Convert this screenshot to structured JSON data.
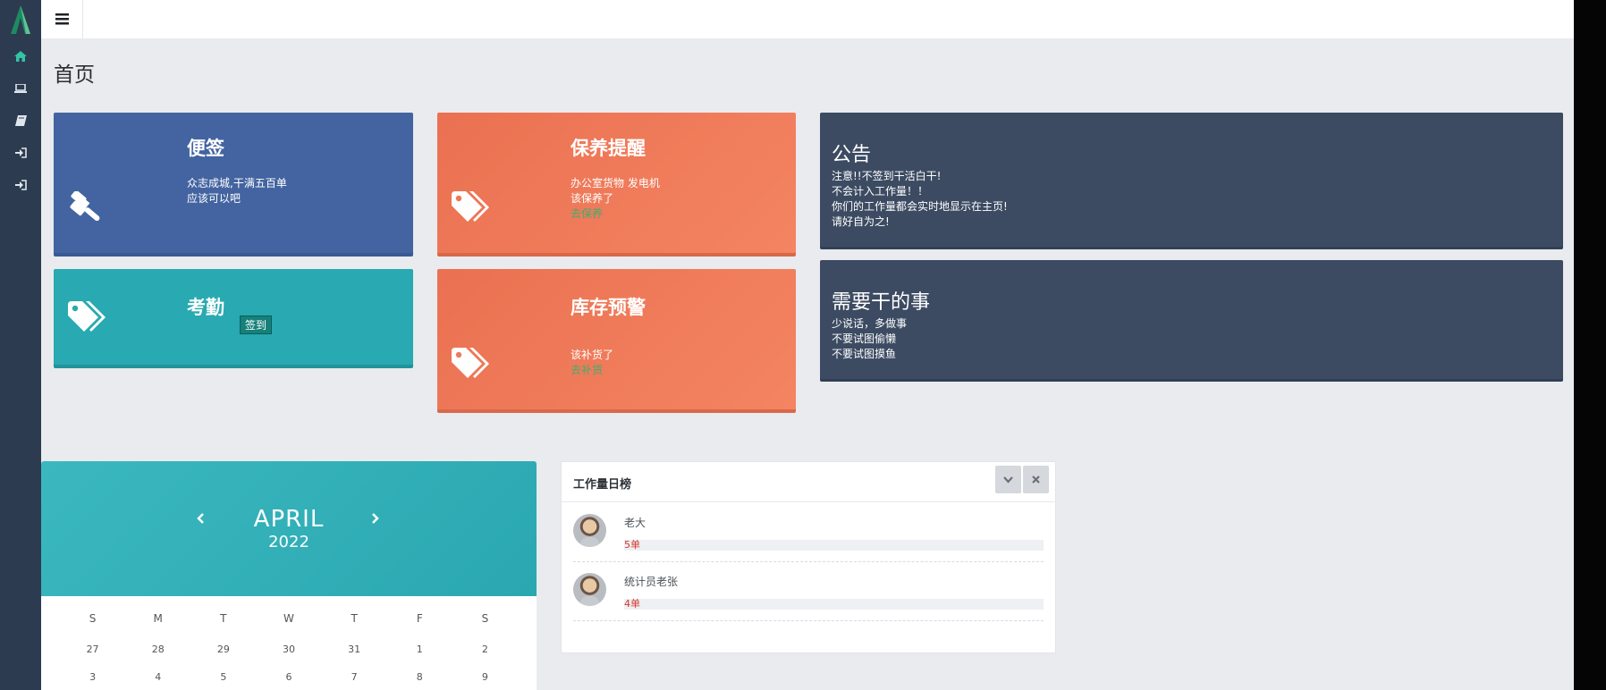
{
  "page": {
    "title": "首页"
  },
  "sidebar": {
    "items": [
      {
        "icon": "home-icon"
      },
      {
        "icon": "laptop-icon"
      },
      {
        "icon": "book-icon"
      },
      {
        "icon": "sign-in-icon"
      },
      {
        "icon": "sign-in-icon"
      }
    ]
  },
  "cards": {
    "notes": {
      "title": "便签",
      "lines": [
        "众志成城,干满五百单",
        "应该可以吧"
      ]
    },
    "attendance": {
      "title": "考勤",
      "button": "签到"
    },
    "maintenance": {
      "title": "保养提醒",
      "lines": [
        "办公室货物 发电机",
        "该保养了"
      ],
      "link": "去保养"
    },
    "inventory": {
      "title": "库存预警",
      "lines": [
        "该补货了"
      ],
      "link": "去补货"
    },
    "notice": {
      "title": "公告",
      "lines": [
        "注意!!不签到干活白干!",
        "不会计入工作量！！",
        "你们的工作量都会实时地显示在主页!",
        "请好自为之!"
      ]
    },
    "todo": {
      "title": "需要干的事",
      "lines": [
        "少说话，多做事",
        "不要试图偷懒",
        "不要试图摸鱼"
      ]
    }
  },
  "calendar": {
    "month": "APRIL",
    "year": "2022",
    "days_of_week": [
      "S",
      "M",
      "T",
      "W",
      "T",
      "F",
      "S"
    ],
    "weeks": [
      [
        "27",
        "28",
        "29",
        "30",
        "31",
        "1",
        "2"
      ],
      [
        "3",
        "4",
        "5",
        "6",
        "7",
        "8",
        "9"
      ]
    ]
  },
  "ranking": {
    "title": "工作量日榜",
    "entries": [
      {
        "name": "老大",
        "label": "5单",
        "value": 5
      },
      {
        "name": "统计员老张",
        "label": "4单",
        "value": 4
      }
    ]
  },
  "colors": {
    "sidebar": "#2c3b4f",
    "blue_card": "#4364a0",
    "teal_card": "#29a9b1",
    "orange_card": "#ef7a58",
    "navy_card": "#3c4b62",
    "accent_green": "#33c3a5",
    "bar_label": "#d6372a"
  }
}
